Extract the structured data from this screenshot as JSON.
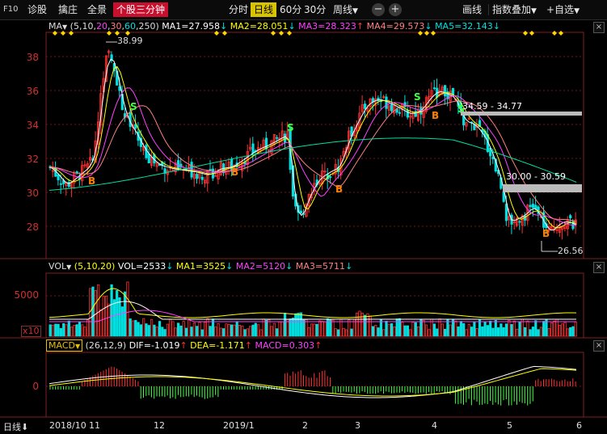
{
  "toolbar": {
    "code": "F10",
    "items": [
      "诊股",
      "擒庄",
      "全景"
    ],
    "active_tool": "个股三分钟",
    "periods": [
      "分时",
      "日线",
      "60分",
      "30分"
    ],
    "selected_period": "日线",
    "week_dropdown": "周线",
    "minus": "−",
    "plus": "+",
    "draw": "画线",
    "overlay": "指数叠加",
    "watchlist": "+自选"
  },
  "ma_legend": {
    "name": "MA",
    "params_prefix": "(5,10,",
    "param20": "20",
    "param30": "30",
    "param60": "60",
    "param250": "250)",
    "ma1": "MA1=27.958",
    "ma2": "MA2=28.051",
    "ma3": "MA3=28.323",
    "ma4": "MA4=29.573",
    "ma5": "MA5=32.143",
    "arrows": [
      "↓",
      "↓",
      "↑",
      "↓",
      "↓"
    ]
  },
  "vol_legend": {
    "name": "VOL",
    "params": "(5,10,20)",
    "vol": "VOL=2533",
    "ma1": "MA1=3525",
    "ma2": "MA2=5120",
    "ma3": "MA3=5711",
    "arrows": [
      "↓",
      "↓",
      "↓",
      "↓"
    ],
    "unit": "x10",
    "ylabel": "5000"
  },
  "macd_legend": {
    "name": "MACD",
    "params": "(26,12,9)",
    "dif": "DIF=-1.019",
    "dea": "DEA=-1.171",
    "macd": "MACD=0.303",
    "arrows": [
      "↑",
      "↑",
      "↑"
    ],
    "ylabel": "0"
  },
  "price_axis": [
    "38",
    "36",
    "34",
    "32",
    "30",
    "28"
  ],
  "annotations": {
    "high": "38.99",
    "low": "26.56",
    "range1": "34.59 - 34.77",
    "range2": "30.00 - 30.59"
  },
  "x_axis": {
    "period": "日线",
    "labels": [
      "2018/10",
      "11",
      "12",
      "2019/1",
      "2",
      "3",
      "4",
      "5",
      "6"
    ]
  },
  "signals": {
    "buy": "B",
    "sell": "S"
  },
  "colors": {
    "up": "#ff3030",
    "down": "#00e0e0",
    "ma5": "#ffffff",
    "ma10": "#ffff00",
    "ma20": "#ff40ff",
    "ma30": "#ff8080",
    "ma60": "#00e0a0",
    "buy": "#ff8000",
    "sell": "#40ff40"
  }
}
